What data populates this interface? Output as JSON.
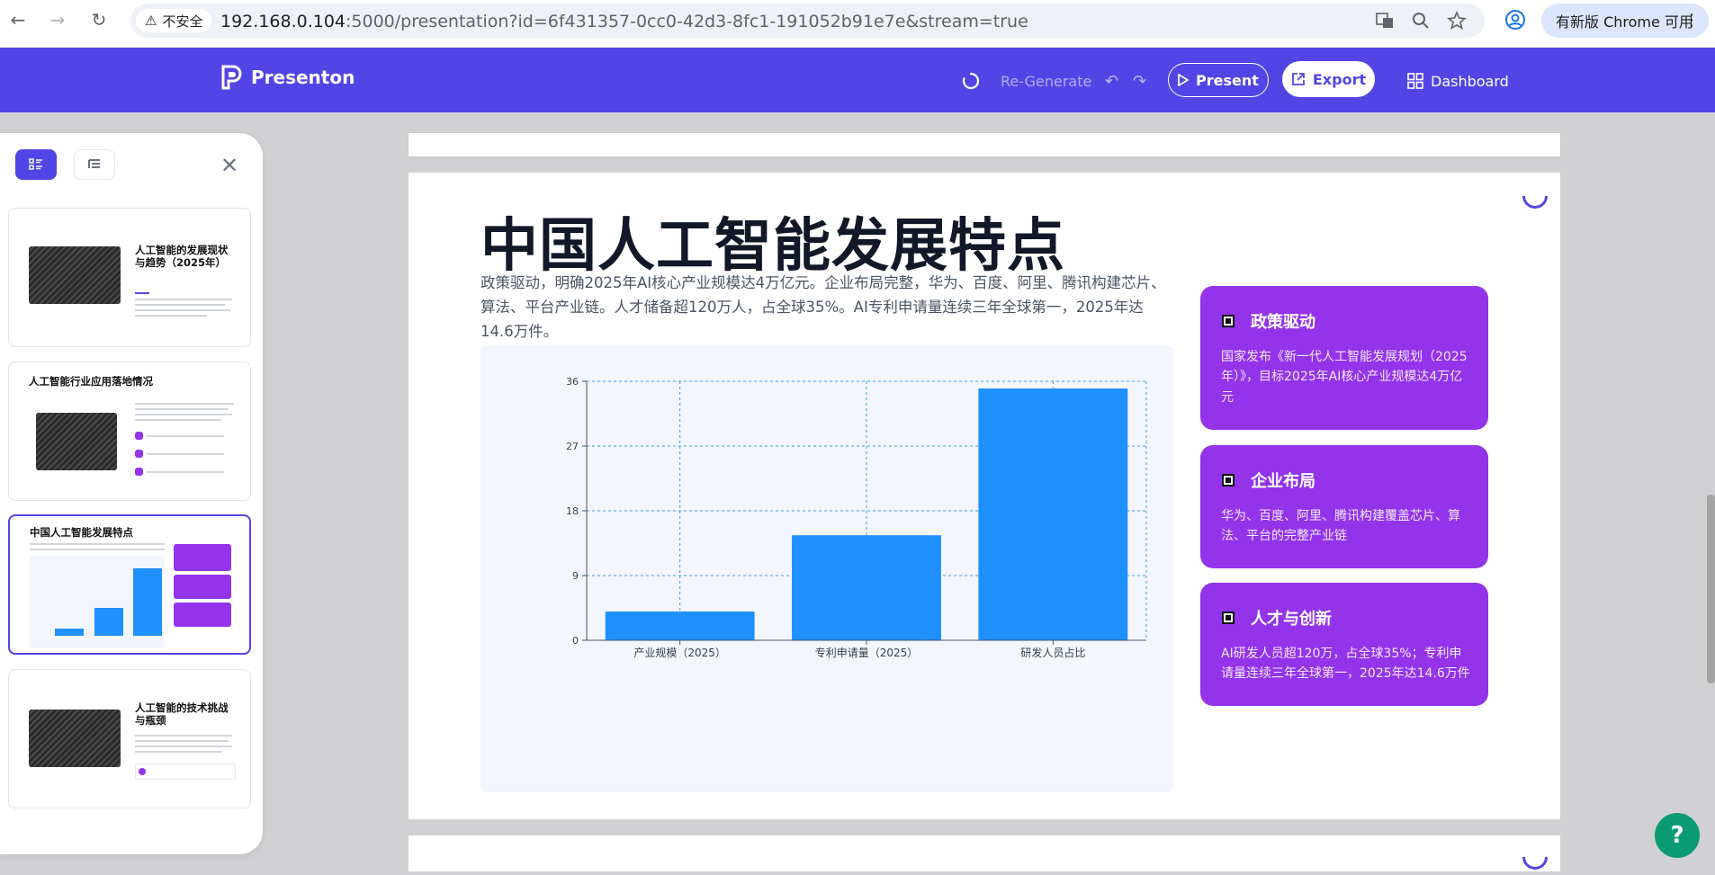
{
  "browser": {
    "insecure_label": "不安全",
    "url_host": "192.168.0.104",
    "url_path": ":5000/presentation?id=6f431357-0cc0-42d3-8fc1-191052b91e7e&stream=true",
    "update_label": "有新版 Chrome 可用"
  },
  "app": {
    "brand": "Presenton",
    "regenerate_label": "Re-Generate",
    "present_label": "Present",
    "export_label": "Export",
    "dashboard_label": "Dashboard",
    "accent_color": "#5146e5"
  },
  "sidebar": {
    "thumbnails": [
      {
        "title": "人工智能的发展现状与趋势（2025年）"
      },
      {
        "title": "人工智能行业应用落地情况"
      },
      {
        "title": "中国人工智能发展特点"
      },
      {
        "title": "人工智能的技术挑战与瓶颈"
      }
    ]
  },
  "slide": {
    "title": "中国人工智能发展特点",
    "description": "政策驱动，明确2025年AI核心产业规模达4万亿元。企业布局完整，华为、百度、阿里、腾讯构建芯片、算法、平台产业链。人才储备超120万人，占全球35%。AI专利申请量连续三年全球第一，2025年达14.6万件。",
    "cards": [
      {
        "title": "政策驱动",
        "text": "国家发布《新一代人工智能发展规划（2025年）》，目标2025年AI核心产业规模达4万亿元"
      },
      {
        "title": "企业布局",
        "text": "华为、百度、阿里、腾讯构建覆盖芯片、算法、平台的完整产业链"
      },
      {
        "title": "人才与创新",
        "text": "AI研发人员超120万，占全球35%；专利申请量连续三年全球第一，2025年达14.6万件"
      }
    ],
    "card_color": "#9333ea"
  },
  "chart_data": {
    "type": "bar",
    "categories": [
      "产业规模（2025）",
      "专利申请量（2025）",
      "研发人员占比"
    ],
    "values": [
      4,
      14.6,
      35
    ],
    "ylim": [
      0,
      36
    ],
    "yticks": [
      0,
      9,
      18,
      27,
      36
    ],
    "grid": true,
    "bar_color": "#1e90ff"
  }
}
